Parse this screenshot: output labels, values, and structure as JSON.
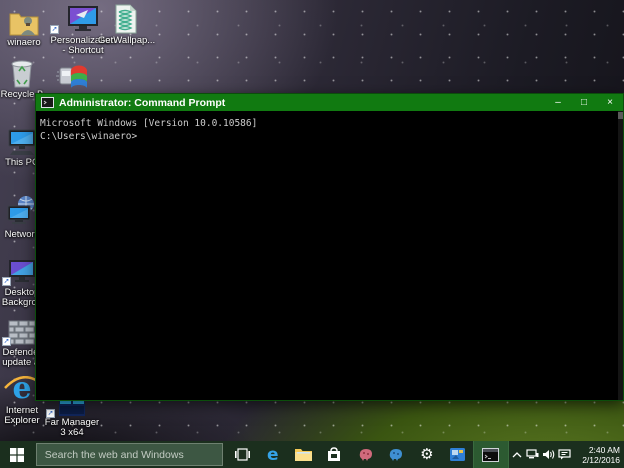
{
  "desktop": {
    "icons": [
      {
        "id": "winaero",
        "label": "winaero"
      },
      {
        "id": "personalization",
        "label": "Personalization - Shortcut"
      },
      {
        "id": "getwallpaper",
        "label": "GetWallpap..."
      },
      {
        "id": "recycle-bin",
        "label": "Recycle B"
      },
      {
        "id": "windows-setup",
        "label": ""
      },
      {
        "id": "this-pc",
        "label": "This PC"
      },
      {
        "id": "network",
        "label": "Network"
      },
      {
        "id": "desktop-background",
        "label": "Desktop Backgrou"
      },
      {
        "id": "defender-update",
        "label": "Defender update a."
      },
      {
        "id": "internet-explorer",
        "label": "Internet Explorer"
      },
      {
        "id": "far-manager",
        "label": "Far Manager 3 x64"
      }
    ]
  },
  "window": {
    "title": "Administrator: Command Prompt",
    "controls": {
      "minimize": "–",
      "maximize": "□",
      "close": "×"
    },
    "console": {
      "line1": "Microsoft Windows [Version 10.0.10586]",
      "line2": "",
      "line3": "C:\\Users\\winaero>"
    }
  },
  "taskbar": {
    "search": {
      "placeholder": "Search the web and Windows"
    },
    "clock": {
      "time": "2:40 AM",
      "date": "2/12/2016"
    }
  },
  "colors": {
    "titlebar_green": "#117a11",
    "taskbar_green": "#1b2f1e",
    "active_button_green": "#2c5a31",
    "console_text": "#cccccc"
  }
}
